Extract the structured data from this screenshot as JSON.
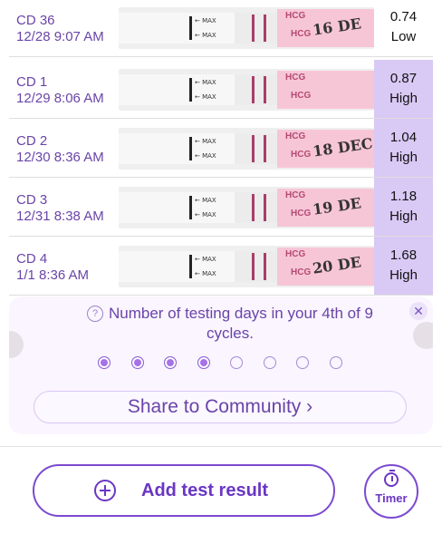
{
  "results": [
    {
      "cd": "CD 36",
      "date": "12/28 9:07 AM",
      "value": "0.74",
      "level": "Low",
      "highlight": false,
      "hand": "16 DE"
    },
    {
      "cd": "CD 1",
      "date": "12/29 8:06 AM",
      "value": "0.87",
      "level": "High",
      "highlight": true,
      "hand": ""
    },
    {
      "cd": "CD 2",
      "date": "12/30 8:36 AM",
      "value": "1.04",
      "level": "High",
      "highlight": true,
      "hand": "18 DEC"
    },
    {
      "cd": "CD 3",
      "date": "12/31 8:38 AM",
      "value": "1.18",
      "level": "High",
      "highlight": true,
      "hand": "19 DE"
    },
    {
      "cd": "CD 4",
      "date": "1/1 8:36 AM",
      "value": "1.68",
      "level": "High",
      "highlight": true,
      "hand": "20 DE"
    }
  ],
  "strip": {
    "max_label": "MAX",
    "brand": "HCG"
  },
  "card": {
    "message": "Number of testing days in your 4th of 9 cycles.",
    "dots_total": 8,
    "dots_filled": 4,
    "share_label": "Share to Community ›"
  },
  "actions": {
    "add_label": "Add test result",
    "timer_label": "Timer"
  },
  "colors": {
    "accent": "#6a36c4",
    "highlight": "#d9c9f5",
    "card_bg": "#faf5ff"
  }
}
